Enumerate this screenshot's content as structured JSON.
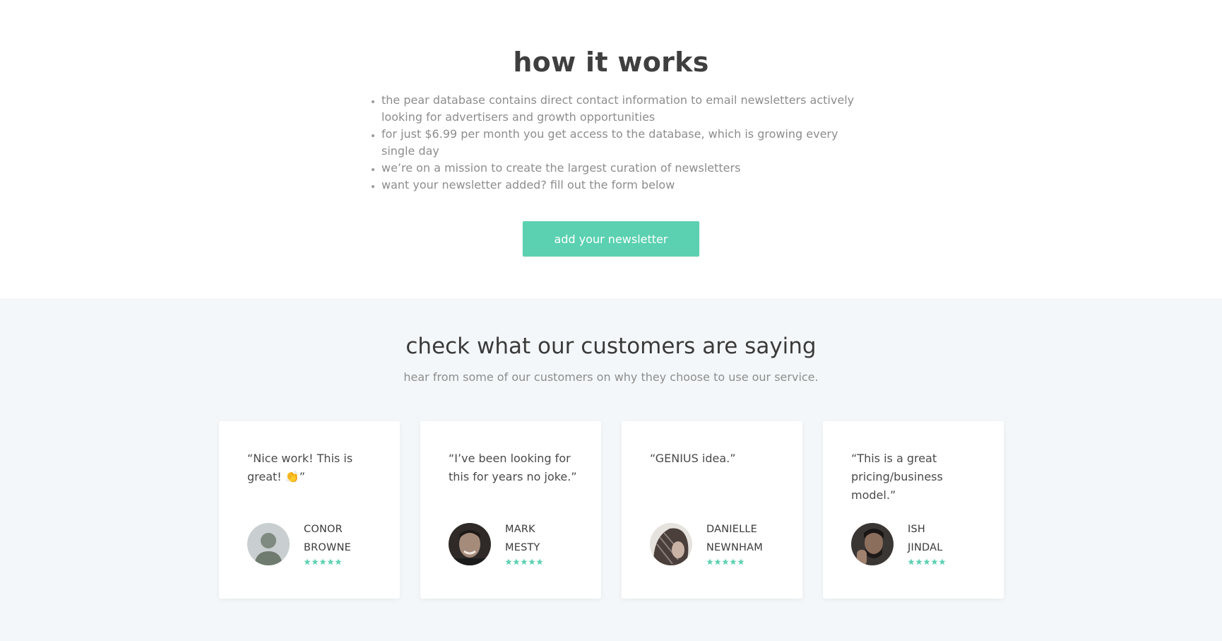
{
  "how_it_works": {
    "title": "how it works",
    "bullets": [
      "the pear database contains direct contact information to email newsletters actively looking for advertisers and growth opportunities",
      "for just $6.99 per month you get access to the database, which is growing every single day",
      "we’re on a mission to create the largest curation of newsletters",
      "want your newsletter added? fill out the form below"
    ],
    "cta_label": "add your newsletter"
  },
  "testimonials": {
    "title": "check what our customers are saying",
    "subtitle": "hear from some of our customers on why they choose to use our service.",
    "cards": [
      {
        "quote": "“Nice work! This is great! 👏”",
        "first_name": "CONOR",
        "last_name": "BROWNE",
        "rating": 5
      },
      {
        "quote": "“I’ve been looking for this for years no joke.”",
        "first_name": "MARK",
        "last_name": "MESTY",
        "rating": 5
      },
      {
        "quote": "“GENIUS idea.”",
        "first_name": "DANIELLE",
        "last_name": "NEWNHAM",
        "rating": 5
      },
      {
        "quote": "“This is a great pricing/business model.”",
        "first_name": "ISH",
        "last_name": "JINDAL",
        "rating": 5
      }
    ]
  },
  "colors": {
    "accent": "#5bd1b1",
    "section_bg": "#f4f7f9",
    "heading": "#3f3f3f",
    "muted_text": "#8d8d8d"
  }
}
